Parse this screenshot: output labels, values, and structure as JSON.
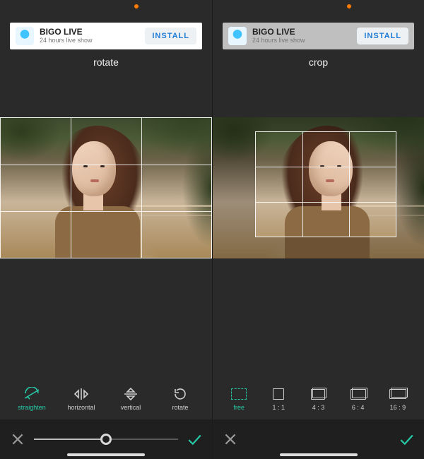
{
  "left": {
    "ad": {
      "title": "BIGO LIVE",
      "subtitle": "24 hours live show",
      "cta": "INSTALL"
    },
    "mode": "rotate",
    "tools": [
      {
        "id": "straighten",
        "label": "straighten",
        "active": true
      },
      {
        "id": "horizontal",
        "label": "horizontal",
        "active": false
      },
      {
        "id": "vertical",
        "label": "vertical",
        "active": false
      },
      {
        "id": "rotate",
        "label": "rotate",
        "active": false
      }
    ],
    "slider": {
      "value": 0,
      "min": -45,
      "max": 45
    }
  },
  "right": {
    "ad": {
      "title": "BIGO LIVE",
      "subtitle": "24 hours live show",
      "cta": "INSTALL"
    },
    "mode": "crop",
    "tools": [
      {
        "id": "free",
        "label": "free",
        "active": true
      },
      {
        "id": "1_1",
        "label": "1 : 1",
        "active": false
      },
      {
        "id": "4_3",
        "label": "4 : 3",
        "active": false
      },
      {
        "id": "6_4",
        "label": "6 : 4",
        "active": false
      },
      {
        "id": "16_9",
        "label": "16 : 9",
        "active": false
      }
    ]
  },
  "colors": {
    "accent": "#25c9a6"
  }
}
